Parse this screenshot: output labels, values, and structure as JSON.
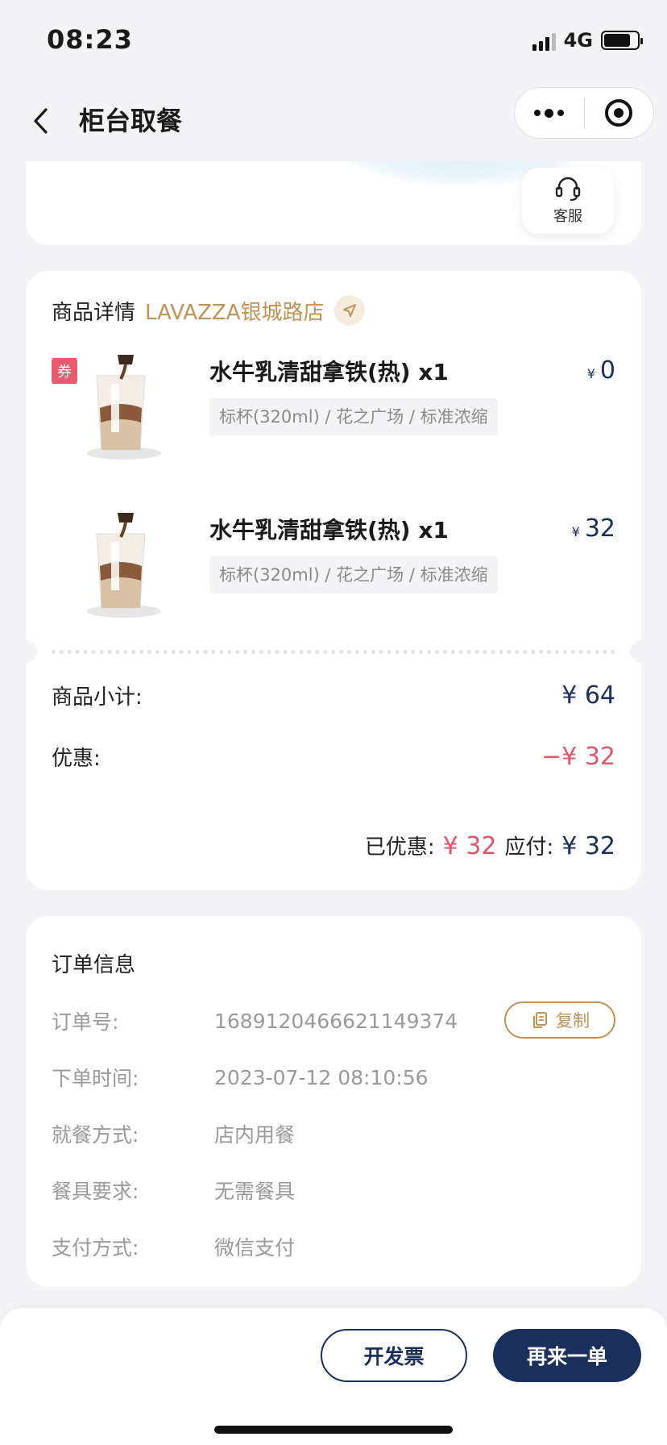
{
  "status": {
    "time": "08:23",
    "network": "4G"
  },
  "nav": {
    "title": "柜台取餐"
  },
  "service": {
    "label": "客服"
  },
  "goods": {
    "title": "商品详情",
    "store": "LAVAZZA银城路店",
    "items": [
      {
        "name": "水牛乳清甜拿铁(热) x1",
        "spec": "标杯(320ml) / 花之广场 / 标准浓缩",
        "currency": "¥",
        "price": "0",
        "tag": "券"
      },
      {
        "name": "水牛乳清甜拿铁(热) x1",
        "spec": "标杯(320ml) / 花之广场 / 标准浓缩",
        "currency": "¥",
        "price": "32"
      }
    ],
    "subtotal_label": "商品小计:",
    "subtotal_value": "¥ 64",
    "discount_label": "优惠:",
    "discount_value": "−¥ 32",
    "saved_label": "已优惠:",
    "saved_value": "¥ 32",
    "payable_label": "应付:",
    "payable_value": "¥ 32"
  },
  "order": {
    "title": "订单信息",
    "copy_label": "复制",
    "rows": [
      {
        "label": "订单号:",
        "value": "1689120466621149374"
      },
      {
        "label": "下单时间:",
        "value": "2023-07-12 08:10:56"
      },
      {
        "label": "就餐方式:",
        "value": "店内用餐"
      },
      {
        "label": "餐具要求:",
        "value": "无需餐具"
      },
      {
        "label": "支付方式:",
        "value": "微信支付"
      }
    ]
  },
  "actions": {
    "invoice": "开发票",
    "reorder": "再来一单"
  },
  "colors": {
    "brand_navy": "#1b2f5c",
    "gold": "#c39255",
    "discount_red": "#e0566a",
    "background": "#f4f4f6"
  },
  "icons": {
    "back": "chevron-left-icon",
    "more": "more-dots-icon",
    "close_mini": "target-icon",
    "service": "headset-icon",
    "store_nav": "navigation-arrow-icon",
    "copy": "copy-icon"
  }
}
